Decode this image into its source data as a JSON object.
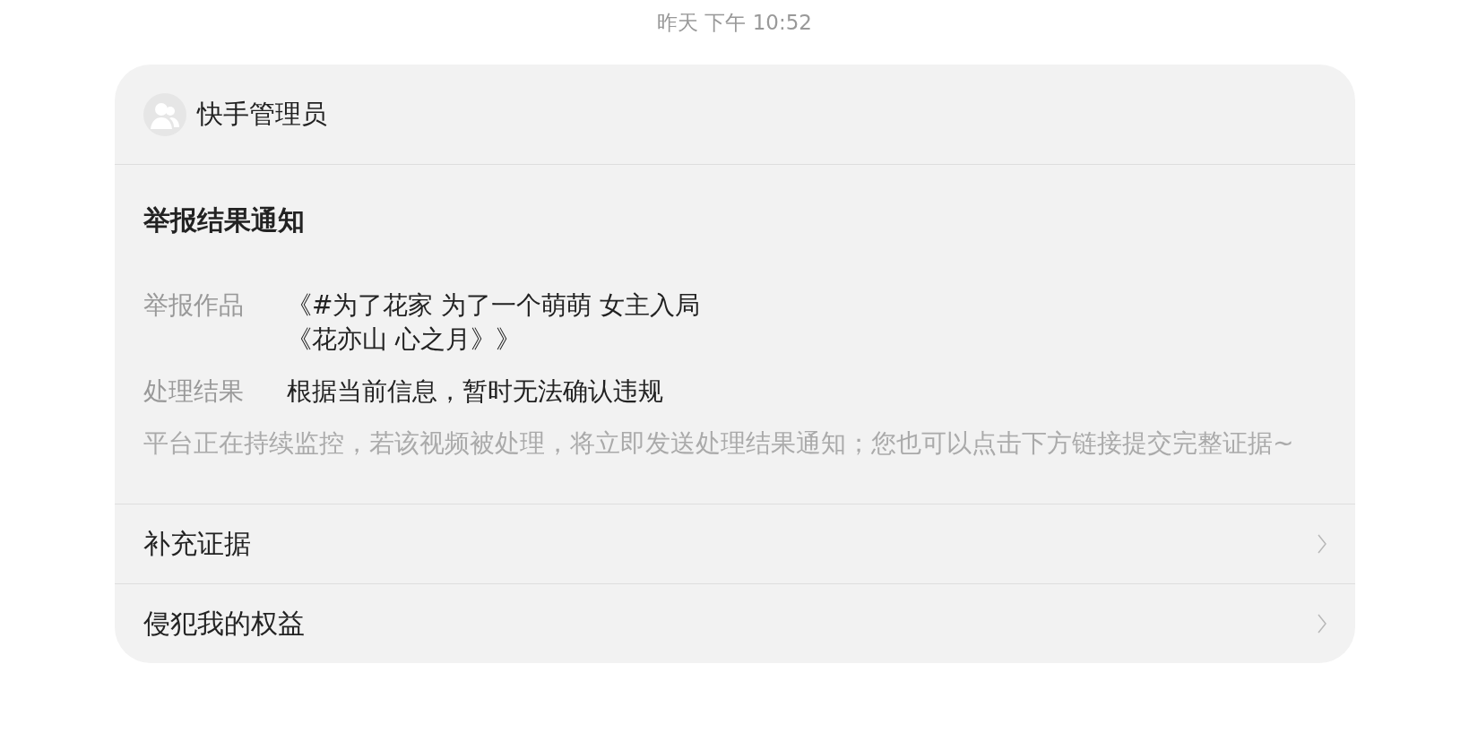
{
  "timestamp": "昨天 下午 10:52",
  "card": {
    "sender": "快手管理员",
    "title": "举报结果通知",
    "fields": [
      {
        "label": "举报作品",
        "lines": [
          "《#为了花家 为了一个萌萌 女主入局",
          "《花亦山 心之月》》"
        ]
      },
      {
        "label": "处理结果",
        "lines": [
          "根据当前信息，暂时无法确认违规"
        ]
      }
    ],
    "note": "平台正在持续监控，若该视频被处理，将立即发送处理结果通知；您也可以点击下方链接提交完整证据~",
    "links": [
      {
        "label": "补充证据"
      },
      {
        "label": "侵犯我的权益"
      }
    ]
  }
}
